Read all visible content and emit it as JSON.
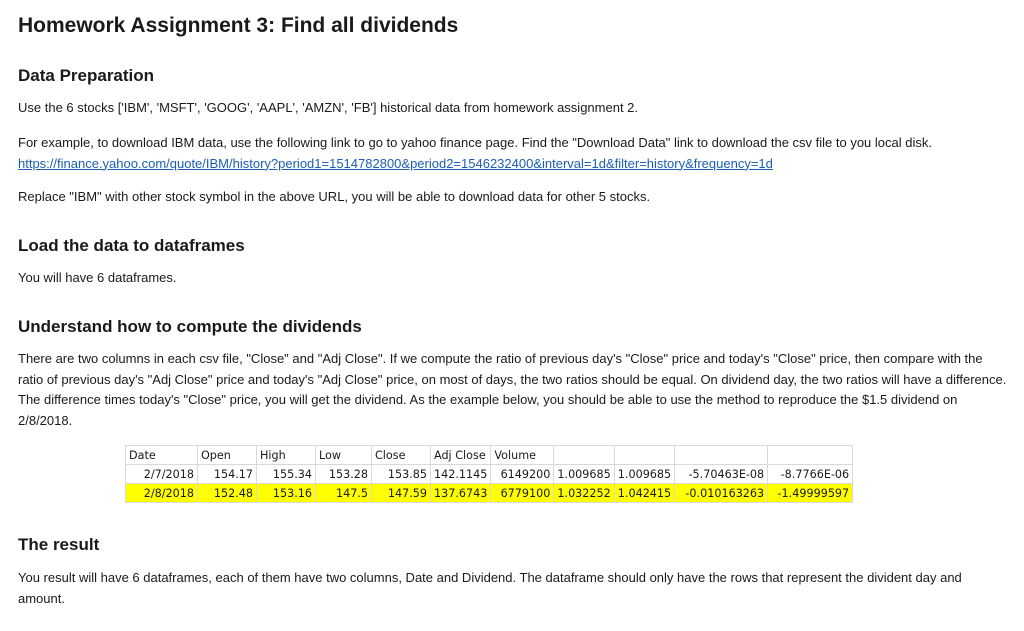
{
  "title": "Homework Assignment 3: Find all dividends",
  "sections": {
    "prep": {
      "heading": "Data Preparation",
      "p1": "Use the 6 stocks ['IBM', 'MSFT', 'GOOG', 'AAPL', 'AMZN', 'FB'] historical data from homework assignment 2.",
      "p2_text": "For example, to download IBM data, use the following link to go to yahoo finance page. Find the \"Download Data\" link to download the csv file to you local disk. ",
      "p2_link": "https://finance.yahoo.com/quote/IBM/history?period1=1514782800&period2=1546232400&interval=1d&filter=history&frequency=1d",
      "p3": "Replace \"IBM\" with other stock symbol in the above URL, you will be able to download data for other 5 stocks."
    },
    "load": {
      "heading": "Load the data to dataframes",
      "p1": "You will have 6 dataframes."
    },
    "understand": {
      "heading": "Understand how to compute the dividends",
      "p1": "There are two columns in each csv file, \"Close\" and \"Adj Close\". If we compute the ratio of previous day's \"Close\" price and today's \"Close\" price, then compare with the ratio of previous day's \"Adj Close\" price and today's \"Adj Close\" price, on most of days, the two ratios should be equal. On dividend day, the two ratios will have a difference. The difference times today's \"Close\" price, you will get the dividend. As the example below, you should be able to use the method to reproduce the $1.5 dividend on 2/8/2018."
    },
    "result": {
      "heading": "The result",
      "p1": "You result will have 6 dataframes, each of them have two columns, Date and Dividend. The dataframe should only have the rows that represent the divident day and amount."
    }
  },
  "table": {
    "headers": [
      "Date",
      "Open",
      "High",
      "Low",
      "Close",
      "Adj Close",
      "Volume",
      "",
      "",
      "",
      ""
    ],
    "rows": [
      [
        "2/7/2018",
        "154.17",
        "155.34",
        "153.28",
        "153.85",
        "142.1145",
        "6149200",
        "1.009685",
        "1.009685",
        "-5.70463E-08",
        "-8.7766E-06"
      ],
      [
        "2/8/2018",
        "152.48",
        "153.16",
        "147.5",
        "147.59",
        "137.6743",
        "6779100",
        "1.032252",
        "1.042415",
        "-0.010163263",
        "-1.49999597"
      ]
    ],
    "highlight_color": "#ffff00"
  }
}
